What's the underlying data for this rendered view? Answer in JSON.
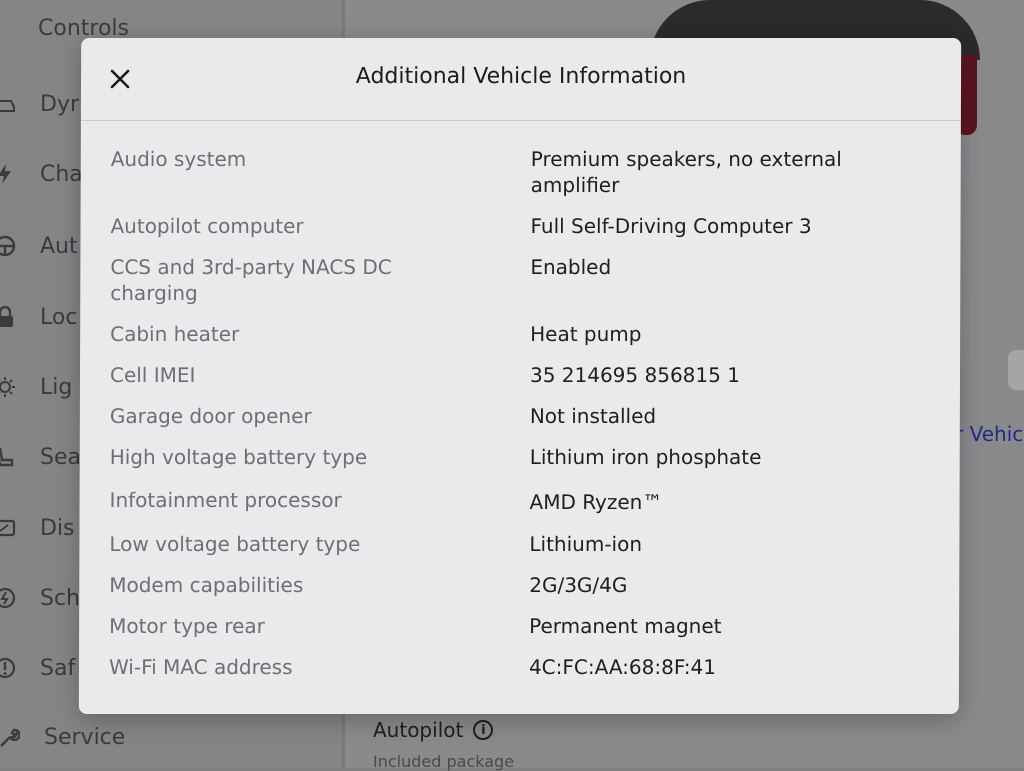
{
  "background": {
    "sidebar_title": "Controls",
    "sidebar_items": [
      {
        "label": "Dyr",
        "icon": "car-icon"
      },
      {
        "label": "Cha",
        "icon": "lightning-icon"
      },
      {
        "label": "Aut",
        "icon": "steering-wheel-icon"
      },
      {
        "label": "Loc",
        "icon": "lock-icon"
      },
      {
        "label": "Lig",
        "icon": "sun-icon"
      },
      {
        "label": "Sea",
        "icon": "seat-icon"
      },
      {
        "label": "Dis",
        "icon": "display-icon"
      },
      {
        "label": "Sch",
        "icon": "schedule-icon"
      },
      {
        "label": "Saf",
        "icon": "alert-icon"
      }
    ],
    "service_label": "Service",
    "vehicle_link": "r Vehic",
    "autopilot_heading": "Autopilot",
    "autopilot_sub": "Included package"
  },
  "modal": {
    "title": "Additional Vehicle Information",
    "rows": [
      {
        "label": "Audio system",
        "value": "Premium speakers, no external amplifier"
      },
      {
        "label": "Autopilot computer",
        "value": "Full Self-Driving Computer 3"
      },
      {
        "label": "CCS and 3rd-party NACS DC charging",
        "value": "Enabled"
      },
      {
        "label": "Cabin heater",
        "value": "Heat pump"
      },
      {
        "label": "Cell IMEI",
        "value": "35 214695 856815 1"
      },
      {
        "label": "Garage door opener",
        "value": "Not installed"
      },
      {
        "label": "High voltage battery type",
        "value": "Lithium iron phosphate"
      },
      {
        "label": "Infotainment processor",
        "value": "AMD Ryzen™"
      },
      {
        "label": "Low voltage battery type",
        "value": "Lithium-ion"
      },
      {
        "label": "Modem capabilities",
        "value": "2G/3G/4G"
      },
      {
        "label": "Motor type rear",
        "value": "Permanent magnet"
      },
      {
        "label": "Wi-Fi MAC address",
        "value": "4C:FC:AA:68:8F:41"
      }
    ]
  },
  "colors": {
    "modal_bg": "#eae9ec",
    "label_text": "#6f6e72",
    "value_text": "#1f1e21",
    "link": "#1f2a8a"
  }
}
